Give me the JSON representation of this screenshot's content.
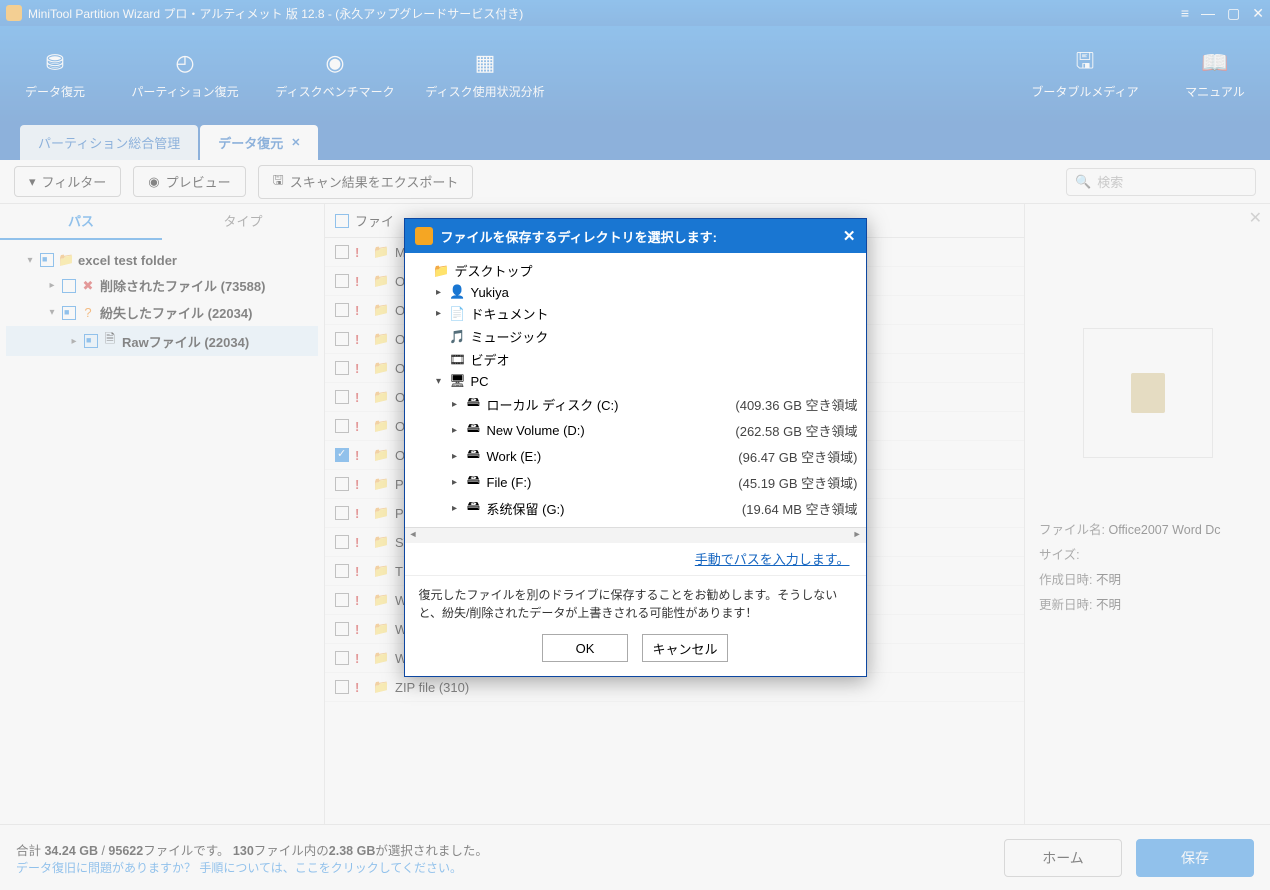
{
  "titlebar": {
    "text": "MiniTool Partition Wizard プロ・アルティメット 版 12.8 - (永久アップグレードサービス付き)"
  },
  "ribbon": {
    "items": [
      {
        "label": "データ復元",
        "icon": "⛃"
      },
      {
        "label": "パーティション復元",
        "icon": "◴"
      },
      {
        "label": "ディスクベンチマーク",
        "icon": "◉"
      },
      {
        "label": "ディスク使用状況分析",
        "icon": "▦"
      }
    ],
    "right": [
      {
        "label": "ブータブルメディア",
        "icon": "🖫"
      },
      {
        "label": "マニュアル",
        "icon": "📖"
      }
    ]
  },
  "tabs": {
    "inactive": "パーティション総合管理",
    "active": "データ復元"
  },
  "toolbar": {
    "filter": "フィルター",
    "preview": "プレビュー",
    "export": "スキャン結果をエクスポート",
    "search_placeholder": "検索"
  },
  "lefttabs": {
    "path": "パス",
    "type": "タイプ"
  },
  "tree": {
    "root": "excel test folder",
    "deleted": "削除されたファイル (73588)",
    "lost": "紛失したファイル (22034)",
    "raw": "Rawファイル (22034)"
  },
  "filehdr": "ファイ",
  "files": [
    "MI",
    "Of",
    "Of",
    "Of",
    "Of",
    "Of",
    "Of",
    {
      "t": "Of",
      "sel": true
    },
    "Ph",
    "PN",
    "SV",
    "TII",
    "WA",
    "Window Media A...",
    "Windows Media ...",
    "ZIP file (310)"
  ],
  "preview": {
    "filename_lbl": "ファイル名:",
    "filename": "Office2007 Word Dc",
    "size_lbl": "サイズ:",
    "size": "",
    "created_lbl": "作成日時:",
    "created": "不明",
    "modified_lbl": "更新日時:",
    "modified": "不明"
  },
  "footer": {
    "total_pre": "合計 ",
    "total_size": "34.24 GB",
    "sep": " / ",
    "total_files": "95622",
    "mid": "ファイルです。  ",
    "sel_files": "130",
    "mid2": "ファイル内の",
    "sel_size": "2.38 GB",
    "tail": "が選択されました。",
    "help": "データ復旧に問題がありますか？ 手順については、ここをクリックしてください。",
    "home": "ホーム",
    "save": "保存"
  },
  "dialog": {
    "title": "ファイルを保存するディレクトリを選択します:",
    "desktop": "デスクトップ",
    "user": "Yukiya",
    "docs": "ドキュメント",
    "music": "ミュージック",
    "video": "ビデオ",
    "pc": "PC",
    "drives": [
      {
        "name": "ローカル ディスク (C:)",
        "space": "(409.36 GB 空き領域"
      },
      {
        "name": "New Volume (D:)",
        "space": "(262.58 GB 空き領域"
      },
      {
        "name": "Work (E:)",
        "space": "(96.47 GB 空き領域)"
      },
      {
        "name": "File (F:)",
        "space": "(45.19 GB 空き領域)"
      },
      {
        "name": "系统保留 (G:)",
        "space": "(19.64 MB 空き領域"
      }
    ],
    "manual": "手動でパスを入力します。",
    "note": "復元したファイルを別のドライブに保存することをお勧めします。そうしないと、紛失/削除されたデータが上書きされる可能性があります！",
    "ok": "OK",
    "cancel": "キャンセル"
  }
}
